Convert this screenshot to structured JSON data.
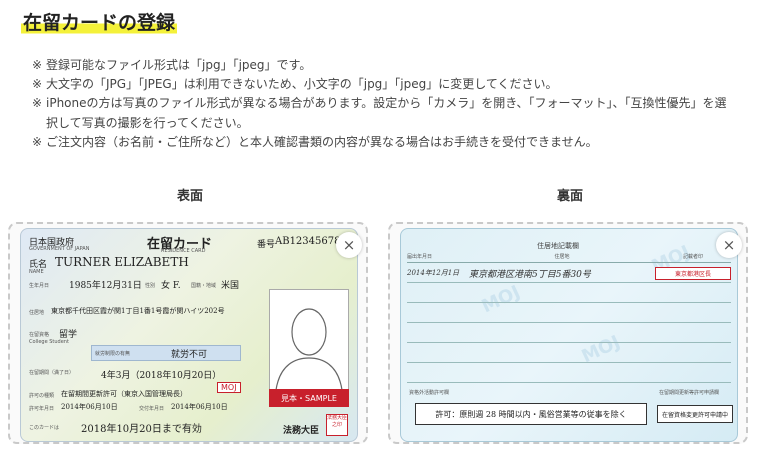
{
  "page": {
    "title": "在留カードの登録"
  },
  "notes": [
    {
      "mark": "※",
      "text": "登録可能なファイル形式は「jpg」「jpeg」です。"
    },
    {
      "mark": "※",
      "text": "大文字の「JPG」「JPEG」は利用できないため、小文字の「jpg」「jpeg」に変更してください。"
    },
    {
      "mark": "※",
      "text": "iPhoneの方は写真のファイル形式が異なる場合があります。設定から「カメラ」を開き、「フォーマット」、「互換性優先」を選択して写真の撮影を行ってください。"
    },
    {
      "mark": "※",
      "text": "ご注文内容（お名前・ご住所など）と本人確認書類の内容が異なる場合はお手続きを受付できません。"
    }
  ],
  "front": {
    "label": "表面",
    "close": "×",
    "card": {
      "country": "日本国政府",
      "country_en": "GOVERNMENT OF JAPAN",
      "card_title": "在留カード",
      "card_title_en": "RESIDENCE CARD",
      "number_label": "番号",
      "number": "AB12345678",
      "name_label": "氏名",
      "name_en": "NAME",
      "name": "TURNER ELIZABETH",
      "dob_label": "生年月日",
      "dob": "1985年12月31日",
      "sex_label": "性別",
      "sex": "女 F.",
      "nationality_label": "国籍・地域",
      "nationality": "米国",
      "address_label": "住居地",
      "address": "東京都千代田区霞が関1丁目1番1号霞が関ハイツ202号",
      "status_label": "在留資格",
      "status": "留学",
      "status_en": "College Student",
      "work_label": "就労制限の有無",
      "work": "就労不可",
      "period_label": "在留期間（満了日）",
      "period": "4年3月（2018年10月20日）",
      "permit_label": "許可の種類",
      "permit": "在留期間更新許可（東京入国管理局長）",
      "permit_date_label": "許可年月日",
      "permit_date": "2014年06月10日",
      "issue_date_label": "交付年月日",
      "issue_date": "2014年06月10日",
      "valid_label": "このカードは",
      "valid": "2018年10月20日まで有効",
      "minister": "法務大臣",
      "seal": "法務大臣之印",
      "moj": "MOJ",
      "sample": "見本・SAMPLE"
    }
  },
  "back": {
    "label": "裏面",
    "close": "×",
    "card": {
      "section_title": "住居地記載欄",
      "col_date": "届出年月日",
      "col_address": "住居地",
      "col_seal": "記載者印",
      "entry_date": "2014年12月1日",
      "entry_address": "東京都港区港南5丁目5番30号",
      "entry_seal": "東京都港区長",
      "permission_label": "資格外活動許可欄",
      "permission": "許可：原則週 28 時間以内・風俗営業等の従事を除く",
      "renewal_label": "在留期間更新等許可申請欄",
      "renewal": "在留資格変更許可申請中",
      "watermark": "MOJ"
    }
  }
}
